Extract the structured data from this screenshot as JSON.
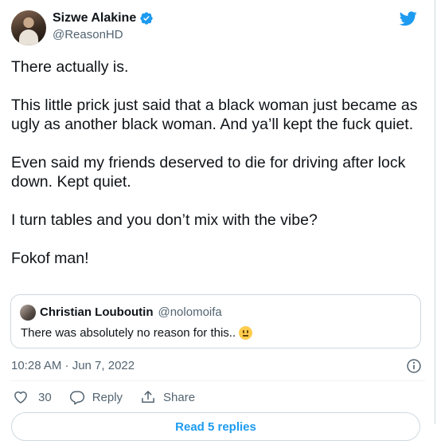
{
  "author": {
    "display_name": "Sizwe Alakine",
    "handle": "@ReasonHD",
    "verified": true
  },
  "tweet": {
    "paragraphs": [
      "There actually is.",
      "This little prick just said that a black woman just became as ugly as another black woman. And ya’ll kept the fuck quiet.",
      "Even said my friends deserved to die for driving after lock down. Kept quiet.",
      "I turn tables and you don’t mix with the vibe?",
      "Fokof man!"
    ]
  },
  "quoted_tweet": {
    "display_name": "Christian Louboutin",
    "handle": "@nolomoifa",
    "text": "There was absolutely no reason for this..",
    "emoji": "neutral-face-emoji"
  },
  "meta": {
    "timestamp": "10:28 AM · Jun 7, 2022"
  },
  "actions": {
    "like_count": "30",
    "reply_label": "Reply",
    "share_label": "Share"
  },
  "read_replies_label": "Read 5 replies",
  "colors": {
    "accent": "#1d9bf0",
    "text": "#0f1419",
    "secondary": "#536471",
    "border": "#cfd9de"
  },
  "icons": [
    "verified-badge-icon",
    "twitter-bird-icon",
    "info-icon",
    "heart-icon",
    "reply-bubble-icon",
    "share-icon"
  ]
}
